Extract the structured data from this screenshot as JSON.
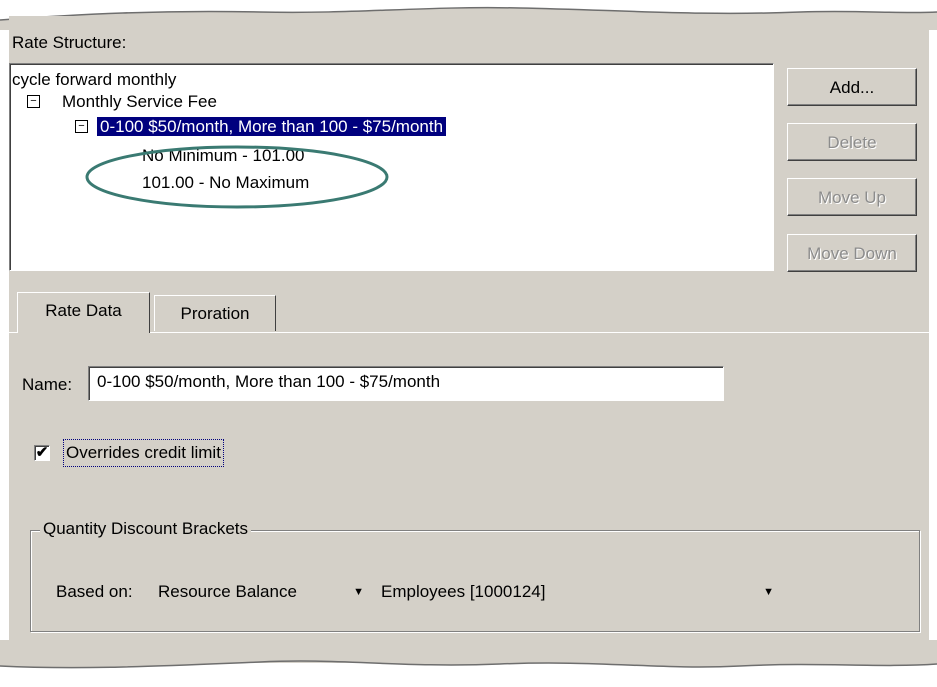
{
  "rate_structure": {
    "label": "Rate Structure:",
    "tree": {
      "root": "cycle  forward  monthly",
      "child": "Monthly Service Fee",
      "selected": "0-100 $50/month, More than 100 - $75/month",
      "leaves": [
        "No Minimum - 101.00",
        "101.00 - No Maximum"
      ],
      "expanded_glyph": "−"
    },
    "buttons": {
      "add": "Add...",
      "delete": "Delete",
      "move_up": "Move Up",
      "move_down": "Move Down"
    }
  },
  "tabs": [
    {
      "label": "Rate Data",
      "active": true
    },
    {
      "label": "Proration",
      "active": false
    }
  ],
  "rate_data": {
    "name_label": "Name:",
    "name_value": "0-100 $50/month, More than 100 - $75/month",
    "overrides": {
      "checked": true,
      "label": "Overrides credit limit",
      "check_glyph": "✔"
    },
    "quantity_discount": {
      "legend": "Quantity Discount Brackets",
      "based_on_label": "Based on:",
      "based_on_value": "Resource Balance",
      "resource_value": "Employees [1000124]",
      "dropdown_glyph": "▼"
    }
  },
  "colors": {
    "panel": "#d4d0c8",
    "selection": "#00007e",
    "annotation_oval": "#3a7a72"
  }
}
